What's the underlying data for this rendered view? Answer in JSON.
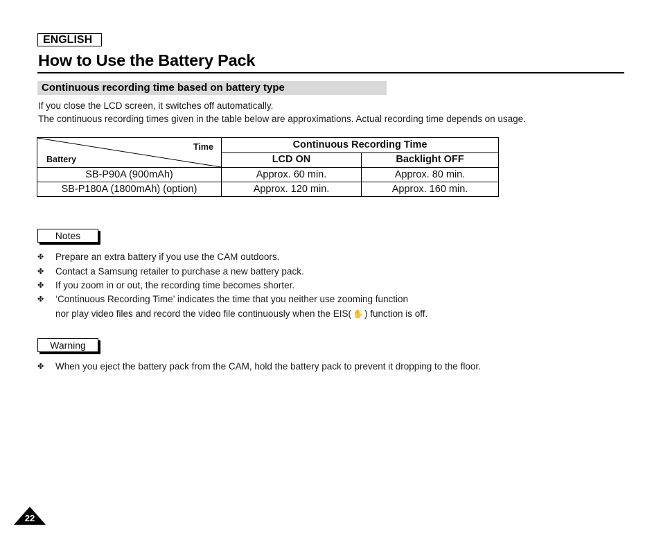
{
  "header": {
    "language": "ENGLISH",
    "title": "How to Use the Battery Pack"
  },
  "section": {
    "heading": "Continuous recording time based on battery type",
    "intro": [
      "If you close the LCD screen, it switches off automatically.",
      "The continuous recording times given in the table below are approximations. Actual recording time depends on usage."
    ]
  },
  "table": {
    "corner_top": "Time",
    "corner_bottom": "Battery",
    "group_header": "Continuous Recording Time",
    "columns": [
      "LCD ON",
      "Backlight OFF"
    ],
    "rows": [
      {
        "battery": "SB-P90A (900mAh)",
        "lcd_on": "Approx. 60 min.",
        "backlight_off": "Approx. 80 min."
      },
      {
        "battery": "SB-P180A (1800mAh) (option)",
        "lcd_on": "Approx. 120 min.",
        "backlight_off": "Approx. 160 min."
      }
    ]
  },
  "notes": {
    "label": "Notes",
    "bullet_icon": "cross-bullet-icon",
    "items": [
      "Prepare an extra battery if you use the CAM outdoors.",
      "Contact a Samsung retailer to purchase a new battery pack.",
      "If you zoom in or out, the recording time becomes shorter.",
      "‘Continuous Recording Time’ indicates the time that you neither use zooming function"
    ],
    "item4_cont_before": "nor play video files and record the video file continuously when the EIS(",
    "item4_cont_after": ") function is off.",
    "eis_icon": "shaking-hand-icon"
  },
  "warning": {
    "label": "Warning",
    "items": [
      "When you eject the battery pack from the CAM, hold the battery pack to prevent it dropping to the floor."
    ]
  },
  "footer": {
    "page_number": "22"
  },
  "bullet_glyph": "✤",
  "eis_glyph": "✋"
}
